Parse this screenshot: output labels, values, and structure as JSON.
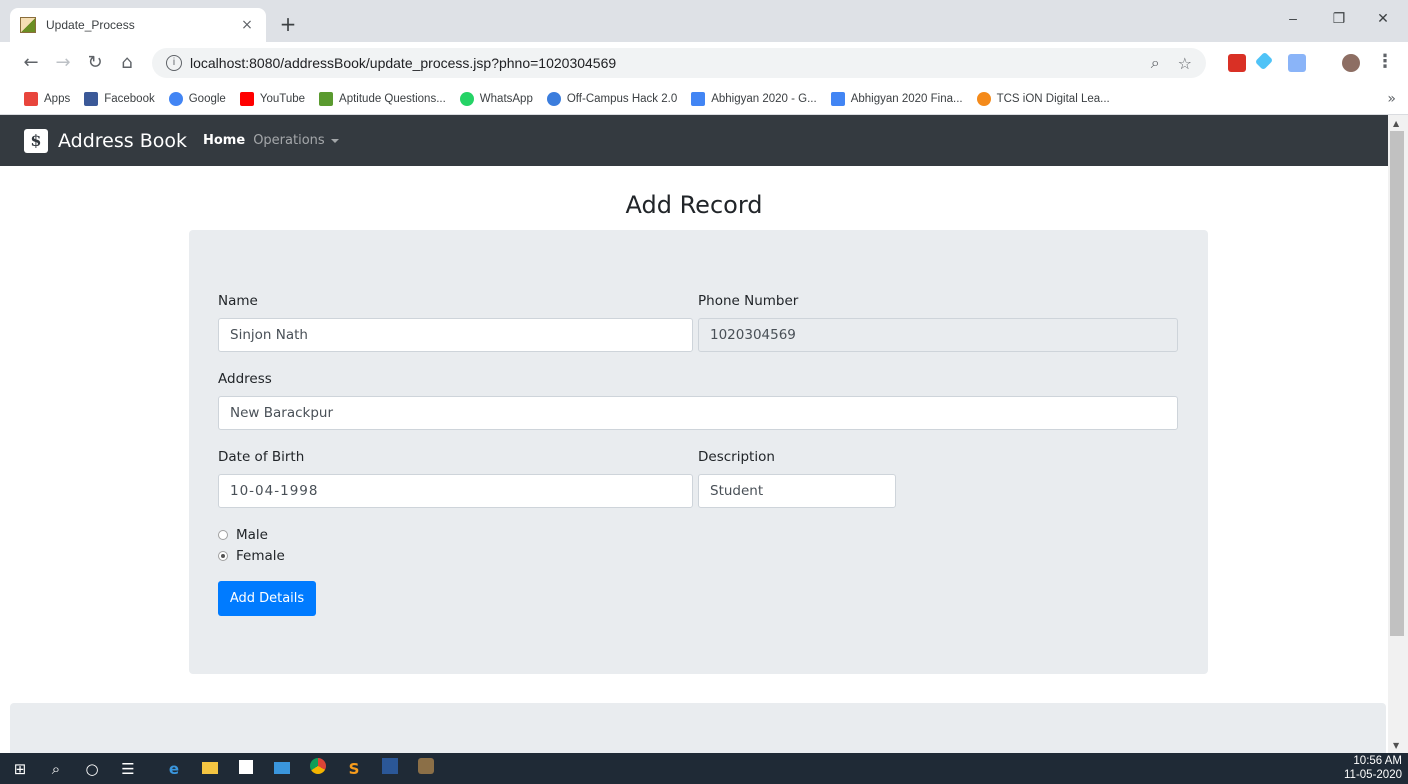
{
  "browser": {
    "tab_title": "Update_Process",
    "tab_close": "×",
    "new_tab": "+",
    "url": "localhost:8080/addressBook/update_process.jsp?phno=1020304569",
    "window_controls": {
      "minimize": "–",
      "maximize": "❐",
      "close": "✕"
    }
  },
  "bookmarks": [
    {
      "label": "Apps",
      "color": "#e8453c"
    },
    {
      "label": "Facebook",
      "color": "#3b5998"
    },
    {
      "label": "Google",
      "color": "#4285f4"
    },
    {
      "label": "YouTube",
      "color": "#ff0000"
    },
    {
      "label": "Aptitude Questions...",
      "color": "#5a9a2f"
    },
    {
      "label": "WhatsApp",
      "color": "#25d366"
    },
    {
      "label": "Off-Campus Hack 2.0",
      "color": "#3b7ddd"
    },
    {
      "label": "Abhigyan 2020 - G...",
      "color": "#4285f4"
    },
    {
      "label": "Abhigyan 2020 Fina...",
      "color": "#4285f4"
    },
    {
      "label": "TCS iON Digital Lea...",
      "color": "#f48a1a"
    }
  ],
  "bookmarks_more": "»",
  "navbar": {
    "brand": "Address Book",
    "brand_logo": "$",
    "home": "Home",
    "operations": "Operations"
  },
  "page": {
    "heading": "Add Record"
  },
  "form": {
    "name_label": "Name",
    "name_value": "Sinjon Nath",
    "phone_label": "Phone Number",
    "phone_value": "1020304569",
    "address_label": "Address",
    "address_value": "New Barackpur",
    "dob_label": "Date of Birth",
    "dob_value": "10-04-1998",
    "description_label": "Description",
    "description_value": "Student",
    "gender_options": [
      "Male",
      "Female"
    ],
    "gender_selected": "Female",
    "submit_label": "Add Details"
  },
  "taskbar": {
    "time": "10:56 AM",
    "date": "11-05-2020"
  },
  "colors": {
    "navbar": "#343a40",
    "primary": "#007bff",
    "card": "#e9ecef"
  }
}
